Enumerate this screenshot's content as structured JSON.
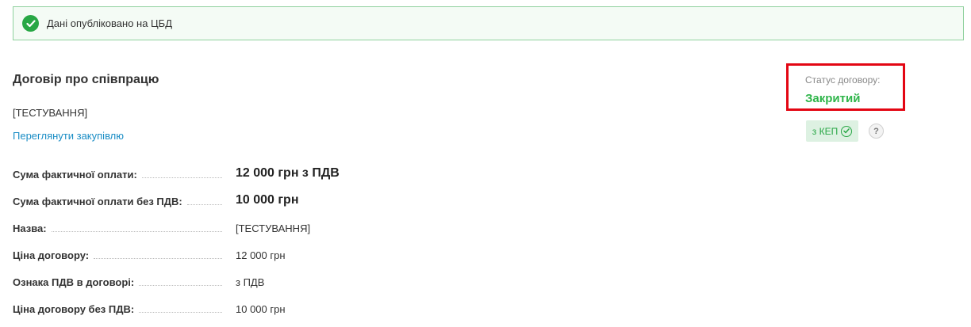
{
  "banner": {
    "message": "Дані опубліковано на ЦБД",
    "icon": "check-circle-icon",
    "color": "#28a745"
  },
  "contract": {
    "title": "Договір про співпрацю",
    "subtitle": "[ТЕСТУВАННЯ]",
    "view_tender_link": "Переглянути закупівлю"
  },
  "details": [
    {
      "label": "Сума фактичної оплати:",
      "value": "12 000 грн з ПДВ",
      "emphasis": true
    },
    {
      "label": "Сума фактичної оплати без ПДВ:",
      "value": "10 000 грн",
      "emphasis": true
    },
    {
      "label": "Назва:",
      "value": "[ТЕСТУВАННЯ]",
      "emphasis": false
    },
    {
      "label": "Ціна договору:",
      "value": "12 000 грн",
      "emphasis": false
    },
    {
      "label": "Ознака ПДВ в договорі:",
      "value": "з ПДВ",
      "emphasis": false
    },
    {
      "label": "Ціна договору без ПДВ:",
      "value": "10 000 грн",
      "emphasis": false
    }
  ],
  "status": {
    "label": "Статус договору:",
    "value": "Закритий",
    "value_color": "#2fb54a",
    "highlight_color": "#e30613"
  },
  "signature": {
    "badge_text": "з КЕП",
    "badge_icon": "check-circle-icon",
    "help_text": "?",
    "help_icon": "question-mark-icon"
  }
}
